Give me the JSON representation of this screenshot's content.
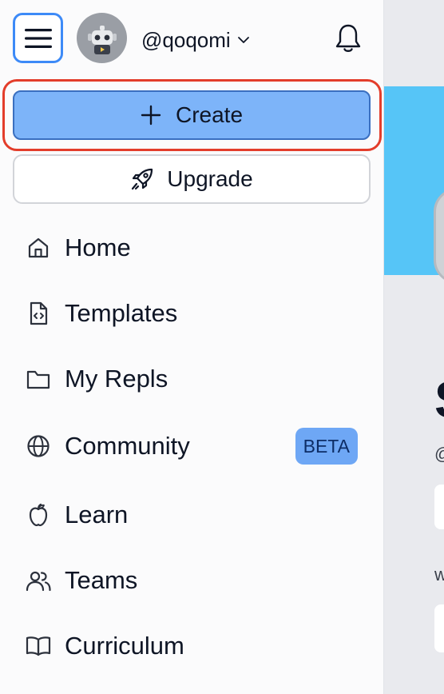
{
  "header": {
    "menu_icon": "hamburger-icon",
    "avatar_icon": "robot-avatar",
    "username": "@qoqomi",
    "bell_icon": "bell-icon"
  },
  "actions": {
    "create_label": "Create",
    "upgrade_label": "Upgrade"
  },
  "nav": {
    "items": [
      {
        "label": "Home",
        "icon": "home-icon"
      },
      {
        "label": "Templates",
        "icon": "template-file-icon"
      },
      {
        "label": "My Repls",
        "icon": "folder-icon"
      },
      {
        "label": "Community",
        "icon": "globe-icon",
        "badge": "BETA"
      },
      {
        "label": "Learn",
        "icon": "apple-icon"
      },
      {
        "label": "Teams",
        "icon": "people-icon"
      },
      {
        "label": "Curriculum",
        "icon": "book-icon"
      }
    ]
  },
  "background_page": {
    "heading_fragment": "S",
    "handle_fragment": "@",
    "text_fragment": "w"
  },
  "colors": {
    "accent": "#3d8af7",
    "create_bg": "#7db4f9",
    "highlight": "#e33d2b",
    "badge_bg": "#6ea7f5",
    "banner": "#56c5f7"
  }
}
